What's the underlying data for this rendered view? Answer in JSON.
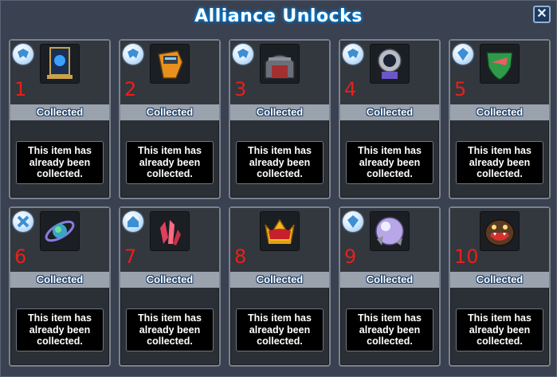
{
  "window": {
    "title": "Alliance Unlocks",
    "close_label": "✕"
  },
  "cards": [
    {
      "number": "1",
      "status": "Collected",
      "message": "This item has already been collected.",
      "icon": "alliance-banner-icon",
      "badge": "aqua-crest-badge-icon"
    },
    {
      "number": "2",
      "status": "Collected",
      "message": "This item has already been collected.",
      "icon": "orange-robot-drone-icon",
      "badge": "aqua-crest-badge-icon"
    },
    {
      "number": "3",
      "status": "Collected",
      "message": "This item has already been collected.",
      "icon": "hangar-building-icon",
      "badge": "aqua-crest-badge-icon"
    },
    {
      "number": "4",
      "status": "Collected",
      "message": "This item has already been collected.",
      "icon": "astronaut-pod-icon",
      "badge": "aqua-crest-badge-icon"
    },
    {
      "number": "5",
      "status": "Collected",
      "message": "This item has already been collected.",
      "icon": "green-shield-emblem-icon",
      "badge": "crystal-badge-icon"
    },
    {
      "number": "6",
      "status": "Collected",
      "message": "This item has already been collected.",
      "icon": "planet-ring-icon",
      "badge": "cross-badge-icon"
    },
    {
      "number": "7",
      "status": "Collected",
      "message": "This item has already been collected.",
      "icon": "red-crystal-icon",
      "badge": "house-badge-icon"
    },
    {
      "number": "8",
      "status": "Collected",
      "message": "This item has already been collected.",
      "icon": "gold-crown-icon",
      "badge": ""
    },
    {
      "number": "9",
      "status": "Collected",
      "message": "This item has already been collected.",
      "icon": "crystal-orb-icon",
      "badge": "crystal-badge-icon"
    },
    {
      "number": "10",
      "status": "Collected",
      "message": "This item has already been collected.",
      "icon": "monster-creature-icon",
      "badge": ""
    }
  ],
  "colors": {
    "number_red": "#e8201a",
    "title_glow": "#0aa0ff",
    "status_bar": "#9aa2ad"
  }
}
